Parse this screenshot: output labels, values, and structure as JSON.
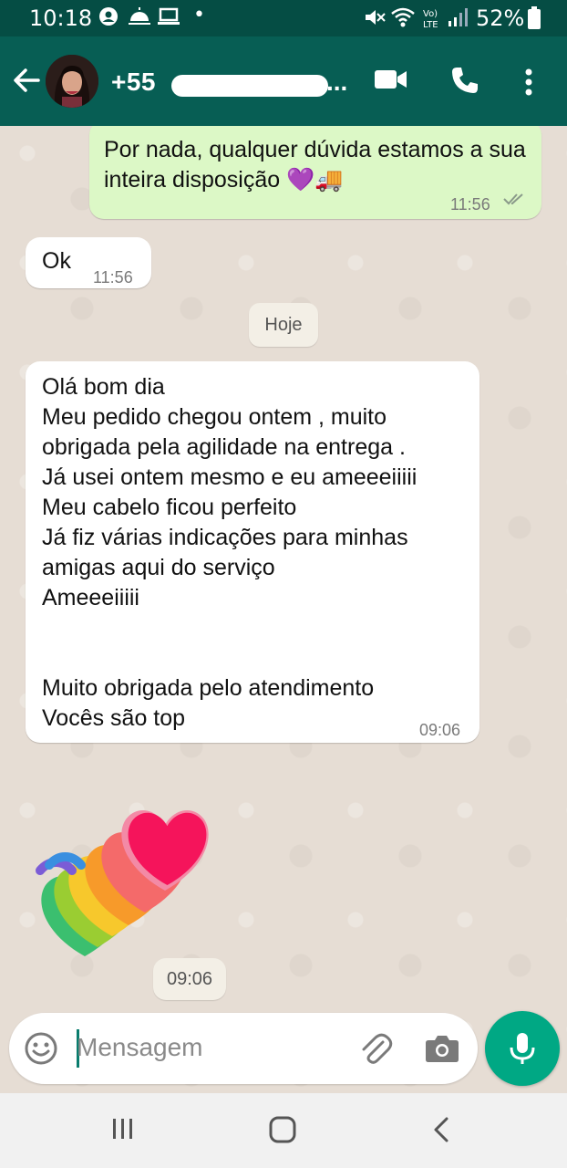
{
  "status_bar": {
    "time": "10:18",
    "dot": "•",
    "battery": "52%"
  },
  "header": {
    "contact_prefix": "+55",
    "contact_ellipsis": "..."
  },
  "messages": [
    {
      "direction": "out",
      "text": "Por nada, qualquer dúvida estamos a sua inteira disposição 💜🚚",
      "time": "11:56"
    },
    {
      "direction": "in",
      "text": "Ok",
      "time": "11:56"
    },
    {
      "direction": "in",
      "lines": [
        "Olá bom dia",
        "Meu pedido chegou ontem , muito",
        "obrigada pela agilidade na entrega .",
        "Já usei ontem mesmo e eu ameeeiiiii",
        "Meu cabelo ficou perfeito",
        "Já fiz várias indicações para minhas",
        "amigas aqui do serviço",
        "Ameeeiiiii",
        "",
        "",
        "Muito obrigada pelo atendimento",
        "Vocês são top"
      ],
      "time": "09:06"
    }
  ],
  "date_divider": "Hoje",
  "sticker": {
    "time": "09:06",
    "icon": "rainbow-heart-sticker"
  },
  "composer": {
    "placeholder": "Mensagem"
  },
  "colors": {
    "header": "#075e54",
    "status": "#054d44",
    "outgoing": "#dcf8c6",
    "incoming": "#ffffff",
    "accent": "#00a884"
  }
}
